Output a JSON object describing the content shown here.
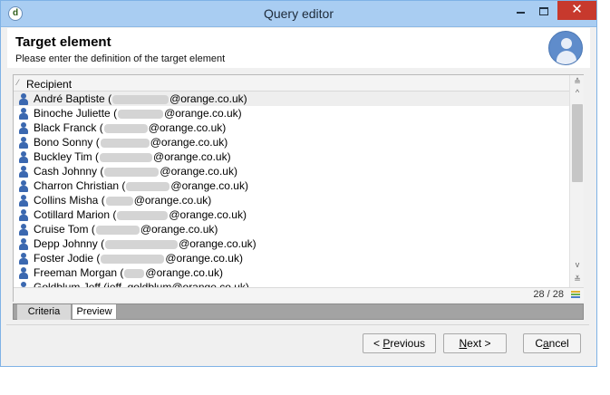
{
  "window": {
    "title": "Query editor",
    "app_icon_glyph": "d",
    "close_glyph": "✕"
  },
  "header": {
    "title": "Target element",
    "subtitle": "Please enter the definition of the target element",
    "avatar_icon": "user-avatar-icon"
  },
  "list": {
    "column_header": "Recipient",
    "sort_glyph": "⁄",
    "rows": [
      {
        "name": "André Baptiste",
        "paren": "(",
        "domain": "@orange.co.uk)"
      },
      {
        "name": "Binoche Juliette",
        "paren": "(",
        "domain": "@orange.co.uk)"
      },
      {
        "name": "Black Franck",
        "paren": "(",
        "domain": "@orange.co.uk)"
      },
      {
        "name": "Bono Sonny",
        "paren": "(",
        "domain": "@orange.co.uk)"
      },
      {
        "name": "Buckley Tim",
        "paren": "(",
        "domain": "@orange.co.uk)"
      },
      {
        "name": "Cash Johnny",
        "paren": "(",
        "domain": "@orange.co.uk)"
      },
      {
        "name": "Charron Christian",
        "paren": "(",
        "domain": "@orange.co.uk)"
      },
      {
        "name": "Collins Misha",
        "paren": "(",
        "domain": "@orange.co.uk)"
      },
      {
        "name": "Cotillard Marion",
        "paren": "(",
        "domain": "@orange.co.uk)"
      },
      {
        "name": "Cruise Tom",
        "paren": "(",
        "domain": "@orange.co.uk)"
      },
      {
        "name": "Depp Johnny",
        "paren": "(",
        "domain": "@orange.co.uk)"
      },
      {
        "name": "Foster Jodie",
        "paren": "(",
        "domain": "@orange.co.uk)"
      },
      {
        "name": "Freeman Morgan",
        "paren": "(",
        "domain": "@orange.co.uk)"
      },
      {
        "name": "Goldblum Jeff",
        "paren": "(",
        "domain": "jeff_goldblum@orange.co.uk)"
      }
    ],
    "count_label": "28 / 28",
    "scroll_up_glyph": "^",
    "scroll_down_glyph": "v",
    "scroll_end_glyph": "≚"
  },
  "tabs": [
    {
      "label": "Criteria"
    },
    {
      "label": "Preview"
    }
  ],
  "buttons": {
    "previous_pre": "< ",
    "previous_u": "P",
    "previous_post": "revious",
    "next_u": "N",
    "next_post": "ext >",
    "cancel_pre": "C",
    "cancel_u": "a",
    "cancel_post": "ncel"
  },
  "colors": {
    "titlebar": "#a9cdf2",
    "close": "#c7392d",
    "person_icon": "#3b68b0"
  }
}
